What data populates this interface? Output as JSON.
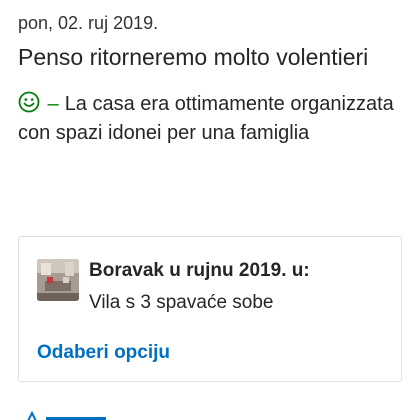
{
  "review": {
    "date": "pon, 02. ruj 2019.",
    "title": "Penso ritorneremo molto volentieri",
    "positive_icon": "smiley-icon",
    "positive_dash": "–",
    "positive_text": "La casa era ottimamente organizzata con spazi idonei per una famiglia"
  },
  "stay": {
    "title": "Boravak u rujnu 2019. u:",
    "room": "Vila s 3 spavaće sobe",
    "select_label": "Odaberi opciju"
  },
  "colors": {
    "positive": "#008009",
    "link": "#0071c2",
    "text": "#262626"
  }
}
